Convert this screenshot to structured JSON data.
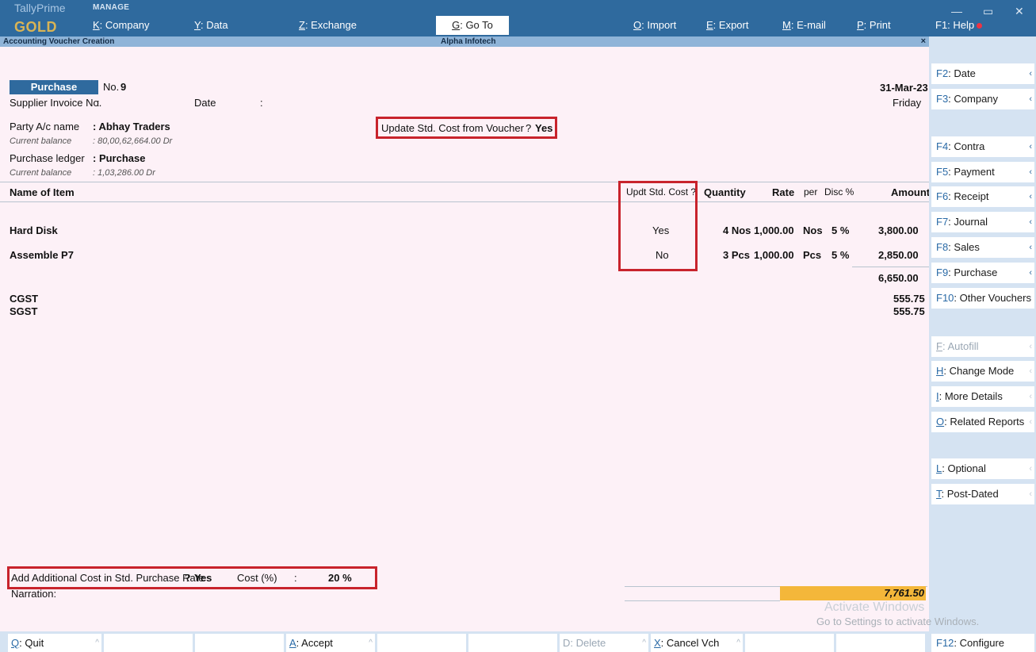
{
  "app": {
    "name": "TallyPrime",
    "edition": "GOLD",
    "manage": "MANAGE"
  },
  "topmenu": {
    "company_key": "K",
    "company_label": ": Company",
    "data_key": "Y",
    "data_label": ": Data",
    "exchange_key": "Z",
    "exchange_label": ": Exchange",
    "goto_key": "G",
    "goto_label": ": Go To",
    "import_key": "O",
    "import_label": ": Import",
    "export_key": "E",
    "export_label": ": Export",
    "email_key": "M",
    "email_label": ": E-mail",
    "print_key": "P",
    "print_label": ": Print",
    "help_label": "F1: Help"
  },
  "window_controls": {
    "minimize": "—",
    "restore": "▭",
    "close": "✕"
  },
  "screen": {
    "title": "Accounting Voucher Creation",
    "company": "Alpha Infotech",
    "close": "×"
  },
  "voucher": {
    "type": "Purchase",
    "no_label": "No.",
    "no": "9",
    "date": "31-Mar-23",
    "day": "Friday",
    "supplier_invoice_label": "Supplier Invoice No.",
    "supplier_invoice_value": ":",
    "date_label": "Date",
    "date_value": ":",
    "party_label": "Party A/c name",
    "party_value": ": Abhay Traders",
    "party_balance_label": "Current balance",
    "party_balance_value": ": 80,00,62,664.00 Dr",
    "ledger_label": "Purchase ledger",
    "ledger_value": ": Purchase",
    "ledger_balance_label": "Current balance",
    "ledger_balance_value": ": 1,03,286.00 Dr",
    "update_std_cost_label": "Update Std. Cost from Voucher",
    "update_std_cost_q": "?",
    "update_std_cost_value": "Yes"
  },
  "table": {
    "headers": {
      "name": "Name of Item",
      "updt": "Updt Std. Cost ?",
      "quantity": "Quantity",
      "rate": "Rate",
      "per": "per",
      "disc": "Disc %",
      "amount": "Amount"
    },
    "rows": [
      {
        "name": "Hard Disk",
        "updt": "Yes",
        "quantity": "4 Nos",
        "rate": "1,000.00",
        "per": "Nos",
        "disc": "5 %",
        "amount": "3,800.00"
      },
      {
        "name": "Assemble P7",
        "updt": "No",
        "quantity": "3 Pcs",
        "rate": "1,000.00",
        "per": "Pcs",
        "disc": "5 %",
        "amount": "2,850.00"
      }
    ],
    "subtotal": "6,650.00",
    "taxes": [
      {
        "name": "CGST",
        "amount": "555.75"
      },
      {
        "name": "SGST",
        "amount": "555.75"
      }
    ]
  },
  "footer": {
    "add_cost_label": "Add Additional Cost in Std. Purchase Rate",
    "add_cost_q": "?",
    "add_cost_value": "Yes",
    "cost_pct_label": "Cost (%)",
    "cost_pct_sep": ":",
    "cost_pct_value": "20 %",
    "narration_label": "Narration:",
    "total": "7,761.50"
  },
  "sidebar": [
    {
      "key": "F2",
      "label": ": Date",
      "enabled": true
    },
    {
      "key": "F3",
      "label": ": Company",
      "enabled": true
    },
    {
      "key": "F4",
      "label": ": Contra",
      "enabled": true
    },
    {
      "key": "F5",
      "label": ": Payment",
      "enabled": true
    },
    {
      "key": "F6",
      "label": ": Receipt",
      "enabled": true
    },
    {
      "key": "F7",
      "label": ": Journal",
      "enabled": true
    },
    {
      "key": "F8",
      "label": ": Sales",
      "enabled": true
    },
    {
      "key": "F9",
      "label": ": Purchase",
      "enabled": true
    },
    {
      "key": "F10",
      "label": ": Other Vouchers",
      "enabled": true
    },
    {
      "key": "F",
      "label": ": Autofill",
      "enabled": false
    },
    {
      "key": "H",
      "label": ": Change Mode",
      "enabled": true
    },
    {
      "key": "I",
      "label": ": More Details",
      "enabled": true
    },
    {
      "key": "O",
      "label": ": Related Reports",
      "enabled": true
    },
    {
      "key": "L",
      "label": ": Optional",
      "enabled": true
    },
    {
      "key": "T",
      "label": ": Post-Dated",
      "enabled": true
    },
    {
      "key": "F12",
      "label": ": Configure",
      "enabled": true
    }
  ],
  "bottombar": {
    "quit_key": "Q",
    "quit_label": ": Quit",
    "accept_key": "A",
    "accept_label": ": Accept",
    "delete_key": "D",
    "delete_label": ": Delete",
    "cancel_key": "X",
    "cancel_label": ": Cancel Vch"
  },
  "watermark": {
    "line1": "Activate Windows",
    "line2": "Go to Settings to activate Windows."
  },
  "colors": {
    "topbar": "#2f6a9e",
    "panel": "#fdf1f7",
    "sidebar": "#d5e3f2",
    "highlight": "#c8232c",
    "total_bg": "#f4b73a"
  }
}
